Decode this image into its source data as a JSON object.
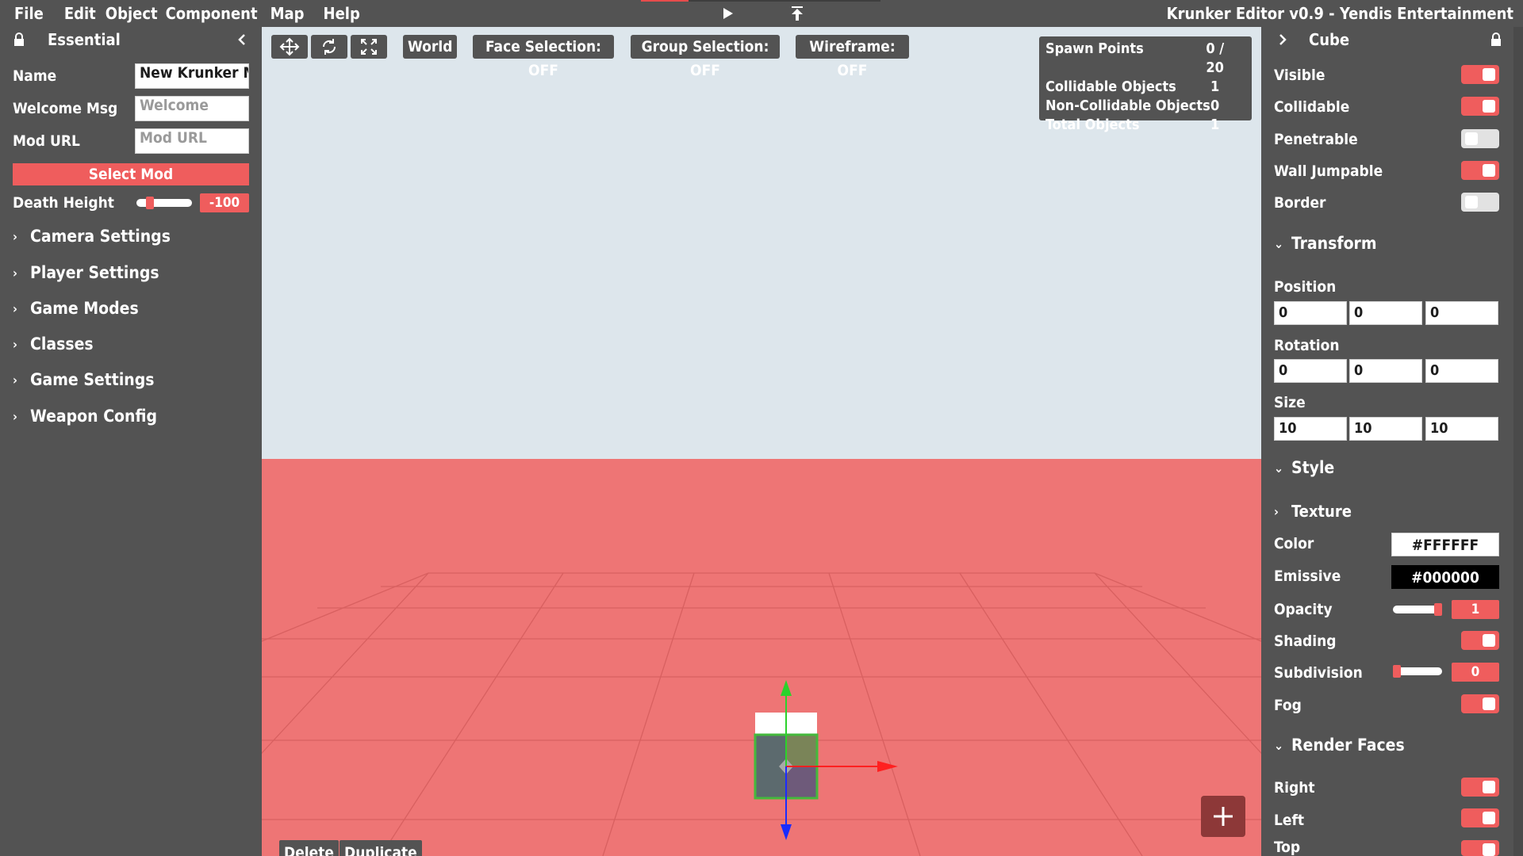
{
  "menu": {
    "items": [
      "File",
      "Edit",
      "Object",
      "Component",
      "Map",
      "Help"
    ],
    "app_title": "Krunker Editor v0.9 - Yendis Entertainment"
  },
  "left_panel": {
    "title": "Essential",
    "fields": {
      "name_label": "Name",
      "name_value": "New Krunker Map",
      "welcome_label": "Welcome Msg",
      "welcome_placeholder": "Welcome",
      "mod_label": "Mod URL",
      "mod_placeholder": "Mod URL"
    },
    "select_mod": "Select Mod",
    "death_height": {
      "label": "Death Height",
      "value": "-100",
      "level": 0.2
    },
    "sections": [
      "Camera Settings",
      "Player Settings",
      "Game Modes",
      "Classes",
      "Game Settings",
      "Weapon Config"
    ]
  },
  "toolbar": {
    "world": "World",
    "face_selection": "Face Selection: OFF",
    "group_selection": "Group Selection: OFF",
    "wireframe": "Wireframe: OFF"
  },
  "stats": {
    "rows": [
      {
        "k": "Spawn Points",
        "v": "0 / 20"
      },
      {
        "k": "Collidable Objects",
        "v": "1"
      },
      {
        "k": "Non-Collidable Objects",
        "v": "0"
      },
      {
        "k": "Total Objects",
        "v": "1"
      }
    ]
  },
  "viewport_buttons": {
    "delete": "Delete",
    "duplicate": "Duplicate",
    "add": "+"
  },
  "right_panel": {
    "title": "Cube",
    "props": [
      {
        "label": "Visible",
        "on": true
      },
      {
        "label": "Collidable",
        "on": true
      },
      {
        "label": "Penetrable",
        "on": false
      },
      {
        "label": "Wall Jumpable",
        "on": true
      },
      {
        "label": "Border",
        "on": false
      }
    ],
    "transform": {
      "title": "Transform",
      "position_label": "Position",
      "position": [
        "0",
        "0",
        "0"
      ],
      "rotation_label": "Rotation",
      "rotation": [
        "0",
        "0",
        "0"
      ],
      "size_label": "Size",
      "size": [
        "10",
        "10",
        "10"
      ]
    },
    "style": {
      "title": "Style",
      "texture": "Texture",
      "color_label": "Color",
      "color_value": "#FFFFFF",
      "emissive_label": "Emissive",
      "emissive_value": "#000000",
      "opacity_label": "Opacity",
      "opacity_value": "1",
      "opacity_level": 1.0,
      "shading_label": "Shading",
      "shading_on": true,
      "subdivision_label": "Subdivision",
      "subdivision_value": "0",
      "subdivision_level": 0.0,
      "fog_label": "Fog",
      "fog_on": true
    },
    "render_faces": {
      "title": "Render Faces",
      "faces": [
        {
          "label": "Right",
          "on": true
        },
        {
          "label": "Left",
          "on": true
        },
        {
          "label": "Top",
          "on": true
        }
      ]
    }
  },
  "colors": {
    "panel": "#535353",
    "accent": "#ef5d5d",
    "sky": "#dde6ec",
    "ground": "#ee7575",
    "add_button": "#8d3838"
  },
  "icons": {
    "move": "move-icon",
    "rotate": "rotate-icon",
    "scale": "scale-icon",
    "play": "play-icon",
    "publish": "publish-icon",
    "lock": "lock-icon",
    "collapse": "chevron-left-icon",
    "expand": "chevron-right-icon"
  }
}
